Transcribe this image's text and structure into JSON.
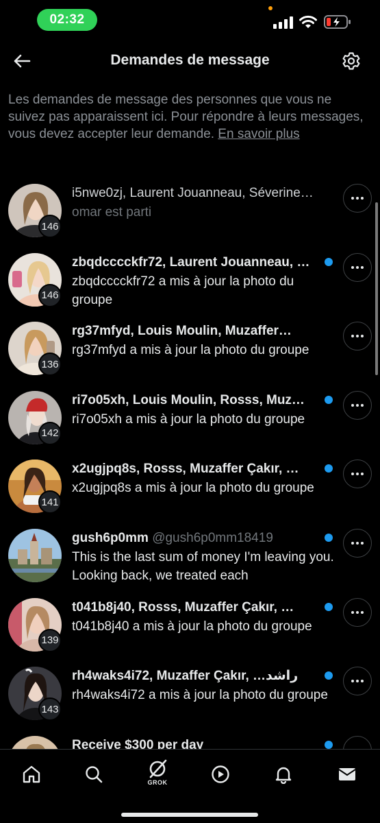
{
  "status_bar": {
    "time": "02:32"
  },
  "header": {
    "title": "Demandes de message"
  },
  "info": {
    "text": "Les demandes de message des personnes que vous ne suivez pas apparaissent ici. Pour répondre à leurs messages, vous devez accepter leur demande. ",
    "link": "En savoir plus"
  },
  "requests": [
    {
      "title": "i5nwe0zj, Laurent Jouanneau, Séverine…",
      "subtitle": "omar est parti",
      "count": "146",
      "unread": false
    },
    {
      "title": "zbqdcccckfr72, Laurent Jouanneau, …",
      "subtitle": "zbqdcccckfr72 a mis à jour la photo du groupe",
      "count": "146",
      "unread": true
    },
    {
      "title": "rg37mfyd, Louis Moulin, Muzaffer…",
      "subtitle": "rg37mfyd a mis à jour la photo du groupe",
      "count": "136",
      "unread": true
    },
    {
      "title": "ri7o05xh, Louis Moulin, Rosss, Muz…",
      "subtitle": "ri7o05xh a mis à jour la photo du groupe",
      "count": "142",
      "unread": true
    },
    {
      "title": "x2ugjpq8s, Rosss, Muzaffer Çakır, …",
      "subtitle": "x2ugjpq8s a mis à jour la photo du groupe",
      "count": "141",
      "unread": true
    },
    {
      "title": "gush6p0mm",
      "handle": "@gush6p0mm18419",
      "subtitle": "This is the last sum of money I'm leaving you. Looking back, we treated each",
      "unread": true
    },
    {
      "title": "t041b8j40, Rosss, Muzaffer Çakır, …",
      "subtitle": "t041b8j40 a mis à jour la photo du groupe",
      "count": "139",
      "unread": true
    },
    {
      "title": "rh4waks4i72, Muzaffer Çakır, …راشد",
      "subtitle": "rh4waks4i72 a mis à jour la photo du groupe",
      "count": "143",
      "unread": true
    },
    {
      "title": "Receive $300 per day",
      "subtitle": "",
      "unread": true
    }
  ],
  "tabs": {
    "grok_label": "GROK"
  },
  "colors": {
    "accent": "#1d9bf0",
    "time_pill": "#30d158",
    "battery_low": "#ff3b30"
  },
  "icons": [
    "back-arrow-icon",
    "gear-icon",
    "more-dots-icon",
    "home-icon",
    "search-icon",
    "grok-icon",
    "play-icon",
    "bell-icon",
    "mail-icon"
  ]
}
